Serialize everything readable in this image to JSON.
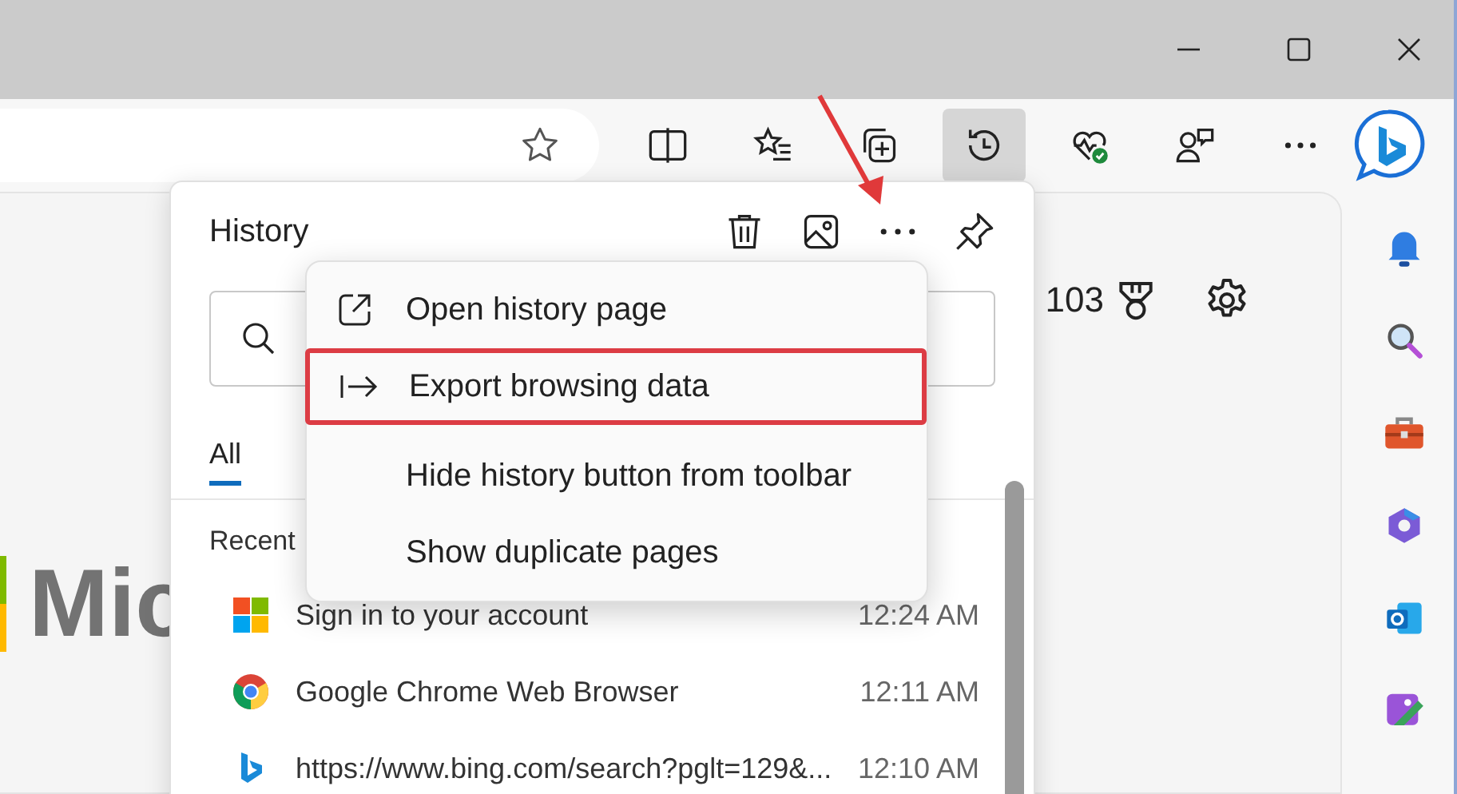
{
  "toolbar": {
    "buttons": [
      {
        "kind": "split",
        "selected": false
      },
      {
        "kind": "favorites",
        "selected": false
      },
      {
        "kind": "collections",
        "selected": false
      },
      {
        "kind": "history",
        "selected": true
      },
      {
        "kind": "health",
        "selected": false
      },
      {
        "kind": "feedback",
        "selected": false
      },
      {
        "kind": "more",
        "selected": false
      }
    ]
  },
  "page": {
    "logo_text": "Mic",
    "points": "103"
  },
  "sidebar": {
    "items": [
      {
        "kind": "bell"
      },
      {
        "kind": "search"
      },
      {
        "kind": "tools"
      },
      {
        "kind": "office"
      },
      {
        "kind": "outlook"
      },
      {
        "kind": "designer"
      }
    ]
  },
  "history": {
    "title": "History",
    "tabs": [
      {
        "label": "All",
        "selected": true
      }
    ],
    "section": "Recent",
    "items": [
      {
        "kind": "microsoft",
        "title": "Sign in to your account",
        "time": "12:24 AM"
      },
      {
        "kind": "chrome",
        "title": "Google Chrome Web Browser",
        "time": "12:11 AM"
      },
      {
        "kind": "bing",
        "title": "https://www.bing.com/search?pglt=129&...",
        "time": "12:10 AM"
      }
    ]
  },
  "menu": {
    "items": [
      {
        "kind": "open",
        "label": "Open history page",
        "highlighted": false
      },
      {
        "kind": "export",
        "label": "Export browsing data",
        "highlighted": true
      },
      {
        "kind": "none",
        "label": "Hide history button from toolbar",
        "highlighted": false
      },
      {
        "kind": "none",
        "label": "Show duplicate pages",
        "highlighted": false
      }
    ]
  }
}
